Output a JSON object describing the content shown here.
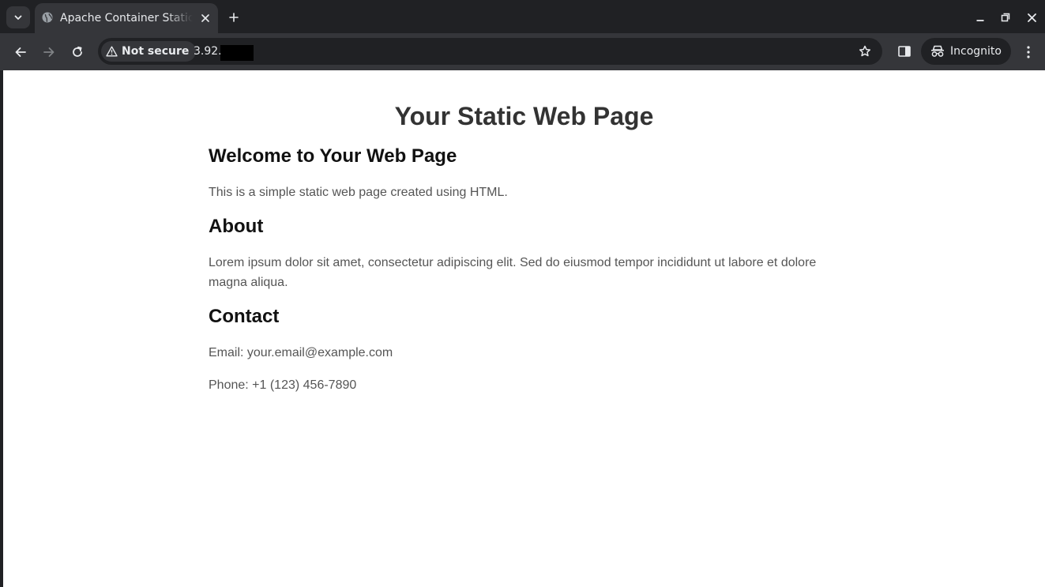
{
  "browser": {
    "tab": {
      "title": "Apache Container Static Web Page"
    },
    "address_bar": {
      "security_label": "Not secure",
      "url_visible": "3.92."
    },
    "profile": {
      "label": "Incognito"
    }
  },
  "page": {
    "heading": "Your Static Web Page",
    "sections": [
      {
        "title": "Welcome to Your Web Page",
        "paragraphs": [
          "This is a simple static web page created using HTML."
        ]
      },
      {
        "title": "About",
        "paragraphs": [
          "Lorem ipsum dolor sit amet, consectetur adipiscing elit. Sed do eiusmod tempor incididunt ut labore et dolore magna aliqua."
        ]
      },
      {
        "title": "Contact",
        "paragraphs": [
          "Email: your.email@example.com",
          "Phone: +1 (123) 456-7890"
        ]
      }
    ]
  },
  "icons": {
    "tab_search": "chevron-down-icon",
    "favicon": "globe-icon",
    "tab_close": "close-icon",
    "new_tab": "plus-icon",
    "minimize": "minimize-icon",
    "restore": "restore-icon",
    "close_window": "close-icon",
    "back": "arrow-left-icon",
    "forward": "arrow-right-icon",
    "reload": "reload-icon",
    "warning": "warning-icon",
    "bookmark": "star-icon",
    "side_panel": "side-panel-icon",
    "incognito": "incognito-icon",
    "menu": "kebab-menu-icon"
  },
  "colors": {
    "chrome_dark": "#202124",
    "chrome_toolbar": "#35363a",
    "chrome_text": "#e8eaed",
    "heading_text": "#333333",
    "body_text": "#555555",
    "page_background": "#ffffff"
  }
}
